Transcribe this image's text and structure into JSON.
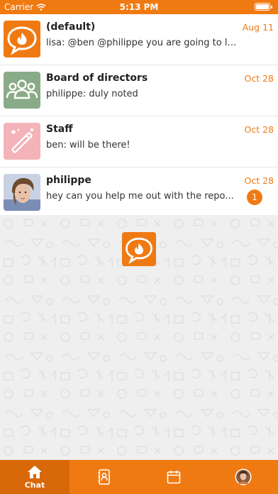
{
  "status_bar": {
    "carrier": "Carrier",
    "time": "5:13 PM"
  },
  "chats": [
    {
      "name": "(default)",
      "preview": "lisa: @ben @philippe you are going to li...",
      "date": "Aug 11",
      "avatar": "chat-logo-icon",
      "unread": ""
    },
    {
      "name": "Board of directors",
      "preview": "philippe: duly noted",
      "date": "Oct 28",
      "avatar": "group-icon",
      "unread": ""
    },
    {
      "name": "Staff",
      "preview": "ben: will be there!",
      "date": "Oct 28",
      "avatar": "magic-wand-icon",
      "unread": ""
    },
    {
      "name": "philippe",
      "preview": "hey can you help me out with the repo...",
      "date": "Oct 28",
      "avatar": "user-photo",
      "unread": "1"
    }
  ],
  "tabs": [
    {
      "label": "Chat",
      "icon": "home-icon",
      "active": true
    },
    {
      "label": "",
      "icon": "contacts-icon",
      "active": false
    },
    {
      "label": "",
      "icon": "calendar-icon",
      "active": false
    },
    {
      "label": "",
      "icon": "profile-avatar",
      "active": false
    }
  ],
  "colors": {
    "accent": "#f07a12",
    "accent_dark": "#d86808",
    "group_avatar": "#8aab87",
    "staff_avatar": "#f3b3b8"
  }
}
